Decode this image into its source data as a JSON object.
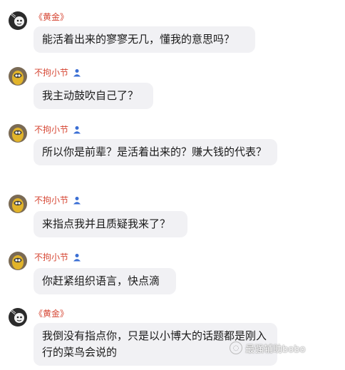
{
  "messages": [
    {
      "avatar": "dark-cartoon-avatar",
      "name": "《黄金》",
      "verified": false,
      "text": "能活着出来的寥寥无几，懂我的意思吗？"
    },
    {
      "avatar": "yellow-creature-avatar",
      "name": "不拘小节",
      "verified": true,
      "text": "我主动鼓吹自己了？"
    },
    {
      "avatar": "yellow-creature-avatar",
      "name": "不拘小节",
      "verified": true,
      "text": "所以你是前辈？是活着出来的？赚大钱的代表？"
    },
    {
      "avatar": "yellow-creature-avatar",
      "name": "不拘小节",
      "verified": true,
      "text": "来指点我并且质疑我来了？"
    },
    {
      "avatar": "yellow-creature-avatar",
      "name": "不拘小节",
      "verified": true,
      "text": "你赶紧组织语言，快点滴"
    },
    {
      "avatar": "dark-cartoon-avatar",
      "name": "《黄金》",
      "verified": false,
      "text": "我倒没有指点你，只是以小博大的话题都是刚入行的菜鸟会说的"
    }
  ],
  "watermark": {
    "text": "最强辅助bobo",
    "icon": "chat-bubble-icon"
  },
  "colors": {
    "name": "#d64532",
    "bubble": "#f1f1f4",
    "verified": "#3b6fd4"
  }
}
